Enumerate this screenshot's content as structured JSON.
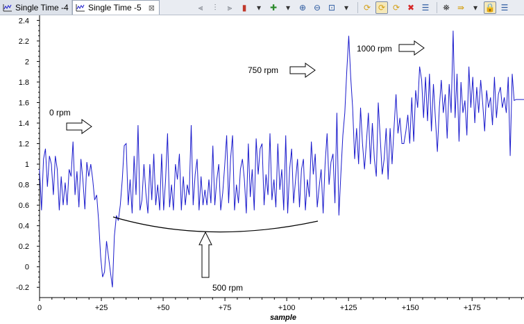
{
  "tabs": [
    {
      "label": "Single Time -4",
      "active": false
    },
    {
      "label": "Single Time -5",
      "active": true
    }
  ],
  "tab_close_glyph": "⊠",
  "toolbar": [
    {
      "name": "align-left-icon",
      "glyph": "⫷",
      "color": "#7a7f88"
    },
    {
      "name": "align-center-icon",
      "glyph": "⫶",
      "color": "#7a7f88"
    },
    {
      "name": "align-right-icon",
      "glyph": "⫸",
      "color": "#7a7f88"
    },
    {
      "name": "cursor-marker-icon",
      "glyph": "▮",
      "color": "#c0392b"
    },
    {
      "name": "dropdown-icon",
      "glyph": "▾",
      "color": "#333333"
    },
    {
      "name": "add-icon",
      "glyph": "✚",
      "color": "#2e8b2e"
    },
    {
      "name": "dropdown-icon",
      "glyph": "▾",
      "color": "#333333"
    },
    {
      "name": "zoom-in-icon",
      "glyph": "⊕",
      "color": "#2c5aa0"
    },
    {
      "name": "zoom-out-icon",
      "glyph": "⊖",
      "color": "#2c5aa0"
    },
    {
      "name": "zoom-fit-icon",
      "glyph": "⊡",
      "color": "#2c5aa0"
    },
    {
      "name": "dropdown-icon",
      "glyph": "▾",
      "color": "#333333"
    },
    {
      "name": "sep",
      "glyph": "",
      "color": ""
    },
    {
      "name": "sync-icon",
      "glyph": "⟳",
      "color": "#d4a017"
    },
    {
      "name": "sync-all-icon",
      "glyph": "⟳",
      "color": "#d4a017",
      "pressed": true
    },
    {
      "name": "refresh-icon",
      "glyph": "⟳",
      "color": "#d4a017"
    },
    {
      "name": "delete-icon",
      "glyph": "✖",
      "color": "#d62828"
    },
    {
      "name": "properties-icon",
      "glyph": "☰",
      "color": "#2c5aa0"
    },
    {
      "name": "sep",
      "glyph": "",
      "color": ""
    },
    {
      "name": "binoculars-icon",
      "glyph": "⛯",
      "color": "#222222"
    },
    {
      "name": "step-forward-icon",
      "glyph": "⇛",
      "color": "#d4a017"
    },
    {
      "name": "dropdown-icon",
      "glyph": "▾",
      "color": "#333333"
    },
    {
      "name": "lock-icon",
      "glyph": "🔒",
      "color": "#d4a017",
      "pressed": true
    },
    {
      "name": "list-icon",
      "glyph": "☰",
      "color": "#2c5aa0"
    }
  ],
  "chart_data": {
    "type": "line",
    "xlabel": "sample",
    "ylabel": "",
    "xlim": [
      0,
      196
    ],
    "ylim": [
      -0.3,
      2.45
    ],
    "x_ticks": [
      0,
      25,
      50,
      75,
      100,
      125,
      150,
      175
    ],
    "x_tick_labels": [
      "0",
      "+25",
      "+50",
      "+75",
      "+100",
      "+125",
      "+150",
      "+175"
    ],
    "y_ticks": [
      -0.2,
      0,
      0.2,
      0.4,
      0.6,
      0.8,
      1,
      1.2,
      1.4,
      1.6,
      1.8,
      2,
      2.2,
      2.4
    ],
    "y_tick_labels": [
      "-0.2",
      "0",
      "0.2",
      "0.4",
      "0.6",
      "0.8",
      "1",
      "1.2",
      "1.4",
      "1.6",
      "1.8",
      "2",
      "2.2",
      "2.4"
    ],
    "grid": false,
    "series_color": "#1a1acc",
    "series": [
      {
        "values": [
          0.95,
          0.55,
          1.05,
          1.15,
          0.78,
          1.08,
          1.0,
          0.7,
          1.08,
          0.95,
          0.55,
          0.88,
          0.6,
          0.82,
          0.6,
          0.95,
          0.88,
          1.22,
          0.7,
          0.93,
          0.58,
          1.05,
          0.85,
          0.56,
          1.02,
          0.88,
          1.0,
          0.85,
          0.65,
          0.7,
          0.45,
          0.1,
          -0.1,
          -0.05,
          0.25,
          0.1,
          -0.05,
          -0.2,
          0.3,
          0.5,
          0.45,
          0.6,
          0.85,
          1.18,
          1.2,
          0.6,
          0.85,
          0.52,
          1.08,
          0.7,
          1.38,
          0.55,
          0.65,
          1.0,
          0.72,
          0.52,
          1.0,
          0.65,
          1.1,
          0.6,
          0.8,
          0.55,
          1.1,
          0.55,
          0.85,
          1.3,
          0.58,
          0.8,
          0.55,
          1.0,
          0.85,
          1.1,
          0.55,
          0.88,
          0.6,
          0.8,
          0.7,
          1.38,
          0.6,
          0.9,
          1.05,
          0.55,
          0.88,
          0.6,
          0.75,
          0.6,
          0.85,
          0.62,
          1.18,
          0.6,
          0.85,
          1.0,
          0.55,
          0.72,
          0.98,
          1.28,
          0.62,
          1.05,
          1.28,
          0.55,
          0.8,
          0.62,
          0.95,
          1.05,
          0.85,
          0.52,
          1.2,
          0.68,
          0.95,
          0.55,
          1.25,
          0.9,
          1.15,
          1.2,
          0.6,
          0.9,
          0.7,
          1.3,
          0.65,
          0.85,
          0.58,
          1.2,
          0.75,
          0.95,
          0.55,
          1.28,
          0.52,
          0.95,
          1.15,
          0.62,
          0.85,
          1.05,
          0.58,
          0.95,
          1.05,
          0.55,
          0.85,
          0.68,
          1.22,
          0.9,
          1.1,
          0.58,
          0.78,
          0.95,
          0.52,
          1.0,
          1.3,
          0.8,
          1.02,
          1.1,
          0.62,
          1.5,
          0.5,
          0.9,
          1.28,
          1.5,
          1.9,
          2.25,
          1.85,
          1.55,
          1.05,
          1.35,
          1.0,
          1.55,
          1.2,
          0.95,
          1.22,
          1.5,
          1.0,
          1.4,
          1.05,
          0.88,
          1.6,
          1.25,
          0.9,
          1.05,
          1.35,
          0.85,
          1.35,
          1.0,
          1.35,
          1.68,
          1.3,
          1.45
        ],
        "tail": [
          1.2,
          1.2,
          1.32,
          1.48,
          1.2,
          1.65,
          1.22,
          1.72,
          1.55,
          1.95,
          1.82,
          1.45,
          1.85,
          1.42,
          1.88,
          1.32,
          1.78,
          1.45,
          1.12,
          1.55,
          1.82,
          1.5,
          1.68,
          1.25,
          1.78,
          1.5,
          2.3,
          1.45,
          1.88,
          1.22,
          1.8,
          1.5,
          1.62,
          1.28,
          1.95,
          1.55,
          1.85,
          1.4,
          1.75,
          1.5,
          1.82,
          1.6,
          1.32,
          1.72,
          1.55,
          1.65,
          1.38,
          1.85,
          1.45,
          1.68,
          1.75,
          1.55,
          1.65,
          1.5,
          1.85,
          1.08,
          1.88,
          1.62,
          1.63,
          1.63,
          1.63,
          1.63,
          1.63
        ]
      }
    ],
    "annotations": [
      {
        "text": "0 rpm",
        "arrow_dir": "right"
      },
      {
        "text": "500 rpm",
        "arrow_dir": "up"
      },
      {
        "text": "750 rpm",
        "arrow_dir": "right"
      },
      {
        "text": "1000 rpm",
        "arrow_dir": "right"
      }
    ]
  }
}
